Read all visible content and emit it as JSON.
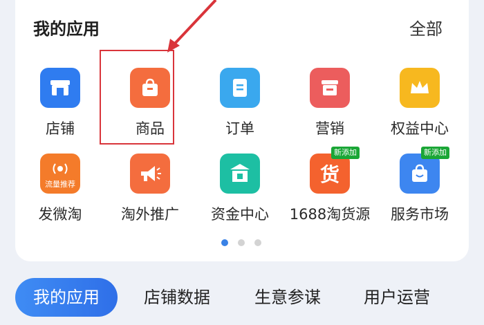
{
  "section": {
    "title": "我的应用",
    "all_label": "全部"
  },
  "apps_row1": [
    {
      "label": "店铺",
      "icon": "store-icon",
      "color": "#2f7cf0"
    },
    {
      "label": "商品",
      "icon": "shopping-bag-icon",
      "color": "#f46d3e"
    },
    {
      "label": "订单",
      "icon": "order-icon",
      "color": "#3aa8ee"
    },
    {
      "label": "营销",
      "icon": "marketing-icon",
      "color": "#ec5d5d"
    },
    {
      "label": "权益中心",
      "icon": "crown-icon",
      "color": "#f7b81f"
    }
  ],
  "apps_row2": [
    {
      "label": "发微淘",
      "icon": "weitao-icon",
      "color": "#f47b2a",
      "tile_text": "流量推荐"
    },
    {
      "label": "淘外推广",
      "icon": "megaphone-icon",
      "color": "#f46d3e"
    },
    {
      "label": "资金中心",
      "icon": "fund-icon",
      "color": "#1dbfa3"
    },
    {
      "label": "1688淘货源",
      "icon": "source-goods-icon",
      "color": "#f4622e",
      "badge": "新添加",
      "tile_text": "货"
    },
    {
      "label": "服务市场",
      "icon": "service-market-icon",
      "color": "#3d86f0",
      "badge": "新添加"
    }
  ],
  "crown_badge": "新添加",
  "pagination": {
    "pages": 3,
    "current": 1
  },
  "tabs": [
    "我的应用",
    "店铺数据",
    "生意参谋",
    "用户运营"
  ],
  "colors": {
    "highlight": "#d9343a",
    "accent": "#3a82e6"
  }
}
